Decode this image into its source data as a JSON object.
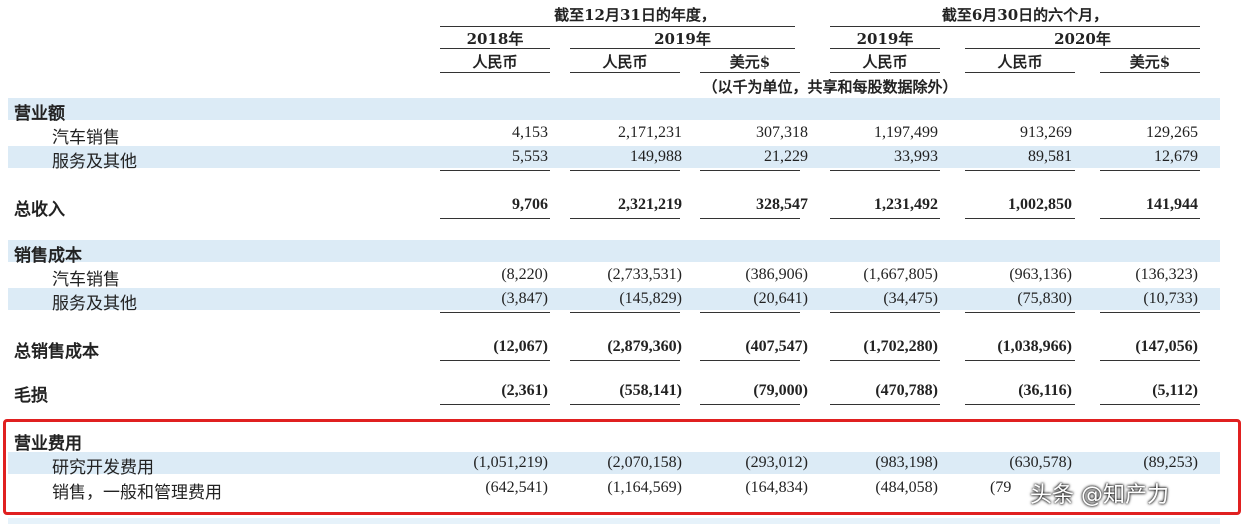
{
  "header": {
    "group1": "截至12月31日的年度，",
    "group2": "截至6月30日的六个月，",
    "years": [
      "2018年",
      "2019年",
      "2019年",
      "2020年"
    ],
    "currencies": [
      "人民币",
      "人民币",
      "美元$",
      "人民币",
      "人民币",
      "美元$"
    ],
    "unit_note": "（以千为单位，共享和每股数据除外）"
  },
  "rows": [
    {
      "label": "营业额",
      "values": []
    },
    {
      "label": "汽车销售",
      "values": [
        "4,153",
        "2,171,231",
        "307,318",
        "1,197,499",
        "913,269",
        "129,265"
      ]
    },
    {
      "label": "服务及其他",
      "values": [
        "5,553",
        "149,988",
        "21,229",
        "33,993",
        "89,581",
        "12,679"
      ]
    },
    {
      "label": "总收入",
      "values": [
        "9,706",
        "2,321,219",
        "328,547",
        "1,231,492",
        "1,002,850",
        "141,944"
      ]
    },
    {
      "label": "销售成本",
      "values": []
    },
    {
      "label": "汽车销售",
      "values": [
        "(8,220)",
        "(2,733,531)",
        "(386,906)",
        "(1,667,805)",
        "(963,136)",
        "(136,323)"
      ]
    },
    {
      "label": "服务及其他",
      "values": [
        "(3,847)",
        "(145,829)",
        "(20,641)",
        "(34,475)",
        "(75,830)",
        "(10,733)"
      ]
    },
    {
      "label": "总销售成本",
      "values": [
        "(12,067)",
        "(2,879,360)",
        "(407,547)",
        "(1,702,280)",
        "(1,038,966)",
        "(147,056)"
      ]
    },
    {
      "label": "毛损",
      "values": [
        "(2,361)",
        "(558,141)",
        "(79,000)",
        "(470,788)",
        "(36,116)",
        "(5,112)"
      ]
    },
    {
      "label": "营业费用",
      "values": []
    },
    {
      "label": "研究开发费用",
      "values": [
        "(1,051,219)",
        "(2,070,158)",
        "(293,012)",
        "(983,198)",
        "(630,578)",
        "(89,253)"
      ]
    },
    {
      "label": "销售，一般和管理费用",
      "values": [
        "(642,541)",
        "(1,164,569)",
        "(164,834)",
        "(484,058)",
        "(79",
        ""
      ]
    }
  ],
  "watermark": "头条 @知产力",
  "colors": {
    "shade": "#dcebf6",
    "highlight_border": "#e02020"
  }
}
